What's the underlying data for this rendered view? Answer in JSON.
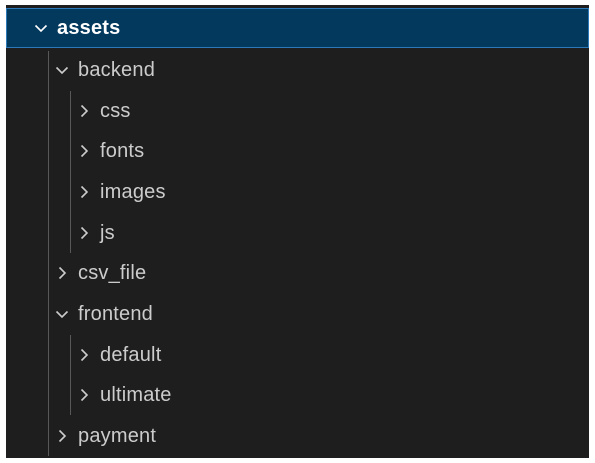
{
  "colors": {
    "background": "#1e1e1e",
    "selection": "#04395e",
    "selection_border": "#2b79b8",
    "text": "#cccccc",
    "guide": "#585858"
  },
  "tree": {
    "root": {
      "label": "assets",
      "state": "expanded",
      "selected": true,
      "icon": "chevron-down-icon"
    },
    "backend": {
      "label": "backend",
      "state": "expanded",
      "icon": "chevron-down-icon"
    },
    "css": {
      "label": "css",
      "state": "collapsed",
      "icon": "chevron-right-icon"
    },
    "fonts": {
      "label": "fonts",
      "state": "collapsed",
      "icon": "chevron-right-icon"
    },
    "images": {
      "label": "images",
      "state": "collapsed",
      "icon": "chevron-right-icon"
    },
    "js": {
      "label": "js",
      "state": "collapsed",
      "icon": "chevron-right-icon"
    },
    "csv_file": {
      "label": "csv_file",
      "state": "collapsed",
      "icon": "chevron-right-icon"
    },
    "frontend": {
      "label": "frontend",
      "state": "expanded",
      "icon": "chevron-down-icon"
    },
    "default": {
      "label": "default",
      "state": "collapsed",
      "icon": "chevron-right-icon"
    },
    "ultimate": {
      "label": "ultimate",
      "state": "collapsed",
      "icon": "chevron-right-icon"
    },
    "payment": {
      "label": "payment",
      "state": "collapsed",
      "icon": "chevron-right-icon"
    }
  }
}
